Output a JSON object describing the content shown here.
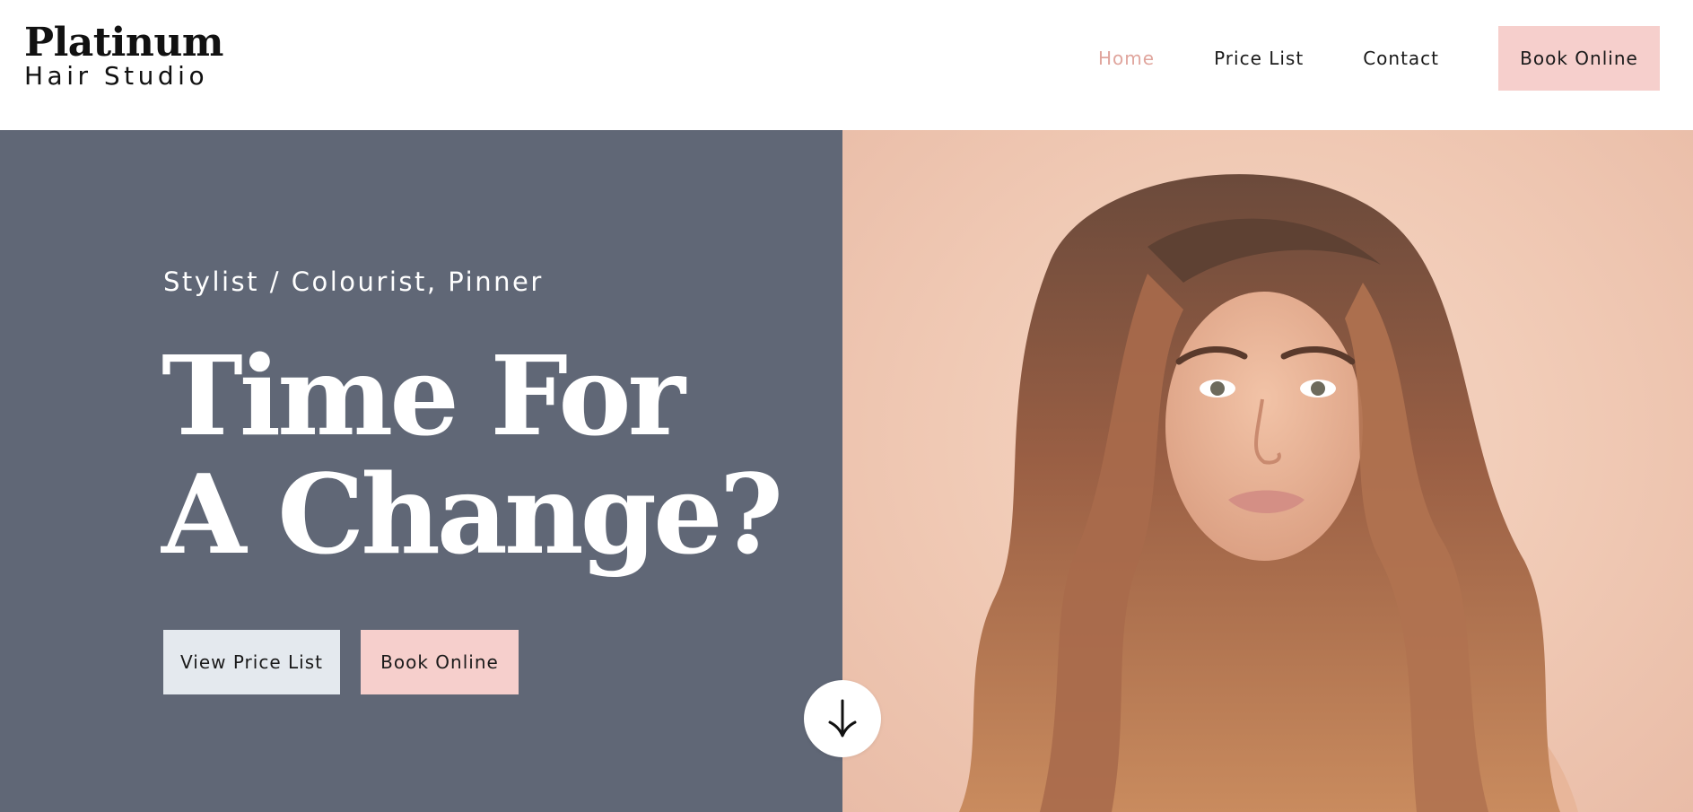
{
  "brand": {
    "name_top": "Platinum",
    "name_bottom": "Hair Studio"
  },
  "nav": {
    "items": [
      {
        "label": "Home",
        "active": true
      },
      {
        "label": "Price List",
        "active": false
      },
      {
        "label": "Contact",
        "active": false
      }
    ],
    "cta_label": "Book Online"
  },
  "hero": {
    "eyebrow": "Stylist / Colourist, Pinner",
    "headline_line1": "Time For",
    "headline_line2": "A Change?",
    "primary_button": "View Price List",
    "secondary_button": "Book Online",
    "scroll_icon": "arrow-down-icon",
    "image_subject": "hero-portrait"
  },
  "colors": {
    "hero_panel": "#606776",
    "accent_pink": "#f6cfcc",
    "active_nav": "#e0a59d",
    "light_button": "#e4e9ee",
    "backdrop_peach": "#f0c9b4"
  }
}
